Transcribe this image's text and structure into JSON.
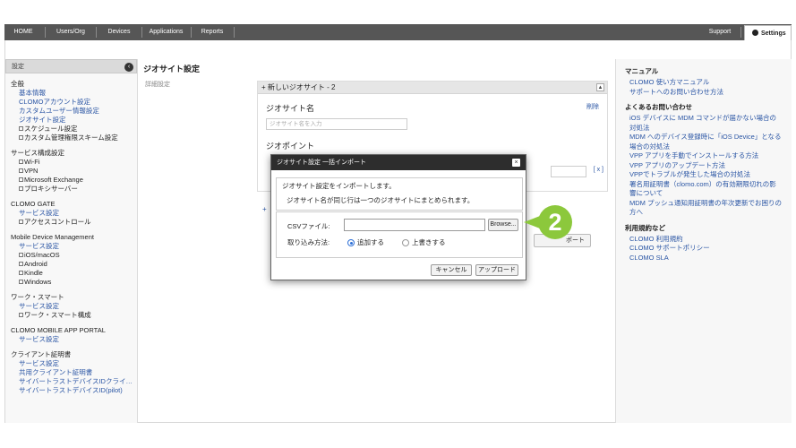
{
  "topnav": {
    "items": [
      "HOME",
      "Users/Org",
      "Devices",
      "Applications",
      "Reports"
    ],
    "support": "Support",
    "settings": "Settings"
  },
  "sidebar": {
    "header": "設定",
    "groups": [
      {
        "heading": "全般",
        "items": [
          {
            "type": "link",
            "text": "基本情報"
          },
          {
            "type": "link",
            "text": "CLOMOアカウント設定"
          },
          {
            "type": "link",
            "text": "カスタムユーザー情報設定"
          },
          {
            "type": "link",
            "text": "ジオサイト設定"
          },
          {
            "type": "sub",
            "text": "スケジュール設定"
          },
          {
            "type": "sub",
            "text": "カスタム管理権限スキーム設定"
          }
        ]
      },
      {
        "heading": "サービス構成設定",
        "items": [
          {
            "type": "sub",
            "text": "Wi-Fi"
          },
          {
            "type": "sub",
            "text": "VPN"
          },
          {
            "type": "sub",
            "text": "Microsoft Exchange"
          },
          {
            "type": "sub",
            "text": "プロキシサーバー"
          }
        ]
      },
      {
        "heading": "CLOMO GATE",
        "items": [
          {
            "type": "link",
            "text": "サービス設定"
          },
          {
            "type": "sub",
            "text": "アクセスコントロール"
          }
        ]
      },
      {
        "heading": "Mobile Device Management",
        "items": [
          {
            "type": "link",
            "text": "サービス設定"
          },
          {
            "type": "sub",
            "text": "iOS/macOS"
          },
          {
            "type": "sub",
            "text": "Android"
          },
          {
            "type": "sub",
            "text": "Kindle"
          },
          {
            "type": "sub",
            "text": "Windows"
          }
        ]
      },
      {
        "heading": "ワーク・スマート",
        "items": [
          {
            "type": "link",
            "text": "サービス設定"
          },
          {
            "type": "sub",
            "text": "ワーク・スマート構成"
          }
        ]
      },
      {
        "heading": "CLOMO MOBILE APP PORTAL",
        "items": [
          {
            "type": "link",
            "text": "サービス設定"
          }
        ]
      },
      {
        "heading": "クライアント証明書",
        "items": [
          {
            "type": "link",
            "text": "サービス設定"
          },
          {
            "type": "link",
            "text": "共用クライアント証明書"
          },
          {
            "type": "link",
            "text": "サイバートラストデバイスIDクライ…"
          },
          {
            "type": "link",
            "text": "サイバートラストデバイスID(pilot)"
          }
        ]
      }
    ]
  },
  "main": {
    "title": "ジオサイト設定",
    "row_label": "詳細設定",
    "panel_title": "+ 新しいジオサイト - 2",
    "panel_toggle": "▲",
    "delete_link": "削除",
    "geosite_name_label": "ジオサイト名",
    "geosite_name_placeholder": "ジオサイト名を入力",
    "geopoint_label": "ジオポイント",
    "remove_point": "[ x ]",
    "add_link": "+",
    "export_button": "ポート"
  },
  "modal": {
    "title": "ジオサイト設定 一括インポート",
    "close": "×",
    "message1": "ジオサイト設定をインポートします。",
    "message2": "ジオサイト名が同じ行は一つのジオサイトにまとめられます。",
    "csv_label": "CSVファイル:",
    "browse": "Browse...",
    "mode_label": "取り込み方法:",
    "mode_add": "追加する",
    "mode_overwrite": "上書きする",
    "mode_selected": "追加する",
    "cancel": "キャンセル",
    "upload": "アップロード"
  },
  "callout": {
    "number": "2",
    "color": "#8cc83c"
  },
  "right_panel": {
    "sections": [
      {
        "heading": "マニュアル",
        "links": [
          "CLOMO 使い方マニュアル",
          "サポートへのお問い合わせ方法"
        ]
      },
      {
        "heading": "よくあるお問い合わせ",
        "links": [
          "iOS デバイスに MDM コマンドが届かない場合の対処法",
          "MDM へのデバイス登録時に「iOS Device」となる場合の対処法",
          "VPP アプリを手動でインストールする方法",
          "VPP アプリのアップデート方法",
          "VPPでトラブルが発生した場合の対処法",
          "署名用証明書（clomo.com）の有効期限切れの影響について",
          "MDM プッシュ通知用証明書の年次更新でお困りの方へ"
        ]
      },
      {
        "heading": "利用規約など",
        "links": [
          "CLOMO 利用規約",
          "CLOMO サポートポリシー",
          "CLOMO SLA"
        ]
      }
    ]
  },
  "colors": {
    "nav_bg": "#565656",
    "link": "#2a55a4",
    "modal_header": "#2d2d2d",
    "accent_green": "#8cc83c",
    "radio_blue": "#2d6fd6"
  }
}
